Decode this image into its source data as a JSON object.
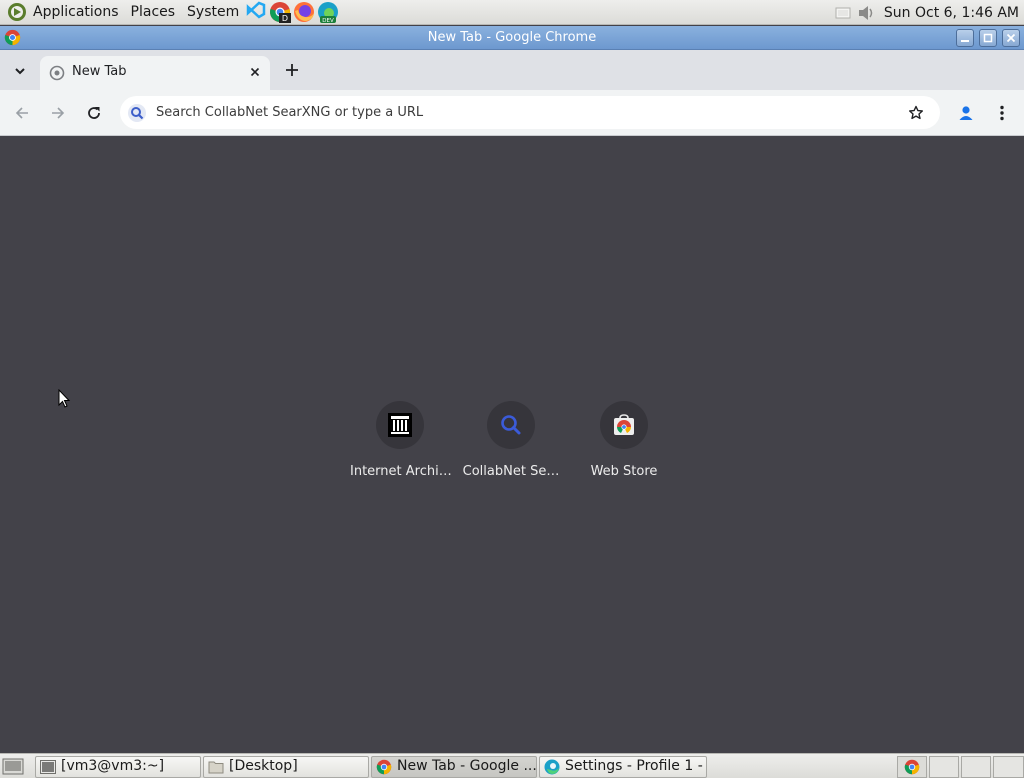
{
  "top_panel": {
    "menus": [
      "Applications",
      "Places",
      "System"
    ],
    "clock": "Sun Oct  6,  1:46 AM",
    "launchers": [
      "vscode-icon",
      "chrome-dev-icon",
      "firefox-icon",
      "edge-dev-icon"
    ]
  },
  "window": {
    "title": "New Tab - Google Chrome"
  },
  "browser": {
    "tab": {
      "title": "New Tab"
    },
    "omnibox": {
      "placeholder": "Search CollabNet SearXNG or type a URL"
    }
  },
  "shortcuts": [
    {
      "label": "Internet Archi…",
      "icon": "archive-building-icon"
    },
    {
      "label": "CollabNet Se…",
      "icon": "search-icon"
    },
    {
      "label": "Web Store",
      "icon": "webstore-icon"
    }
  ],
  "taskbar": {
    "tasks": [
      {
        "label": "[vm3@vm3:~]",
        "icon": "terminal-icon"
      },
      {
        "label": "[Desktop]",
        "icon": "folder-icon"
      },
      {
        "label": "New Tab - Google ...",
        "icon": "chrome-icon"
      },
      {
        "label": "Settings - Profile 1 - ...",
        "icon": "edge-icon"
      }
    ]
  },
  "colors": {
    "content_bg": "#434249",
    "titlebar": "#7ba3d6",
    "accent_blue": "#1a73e8"
  }
}
